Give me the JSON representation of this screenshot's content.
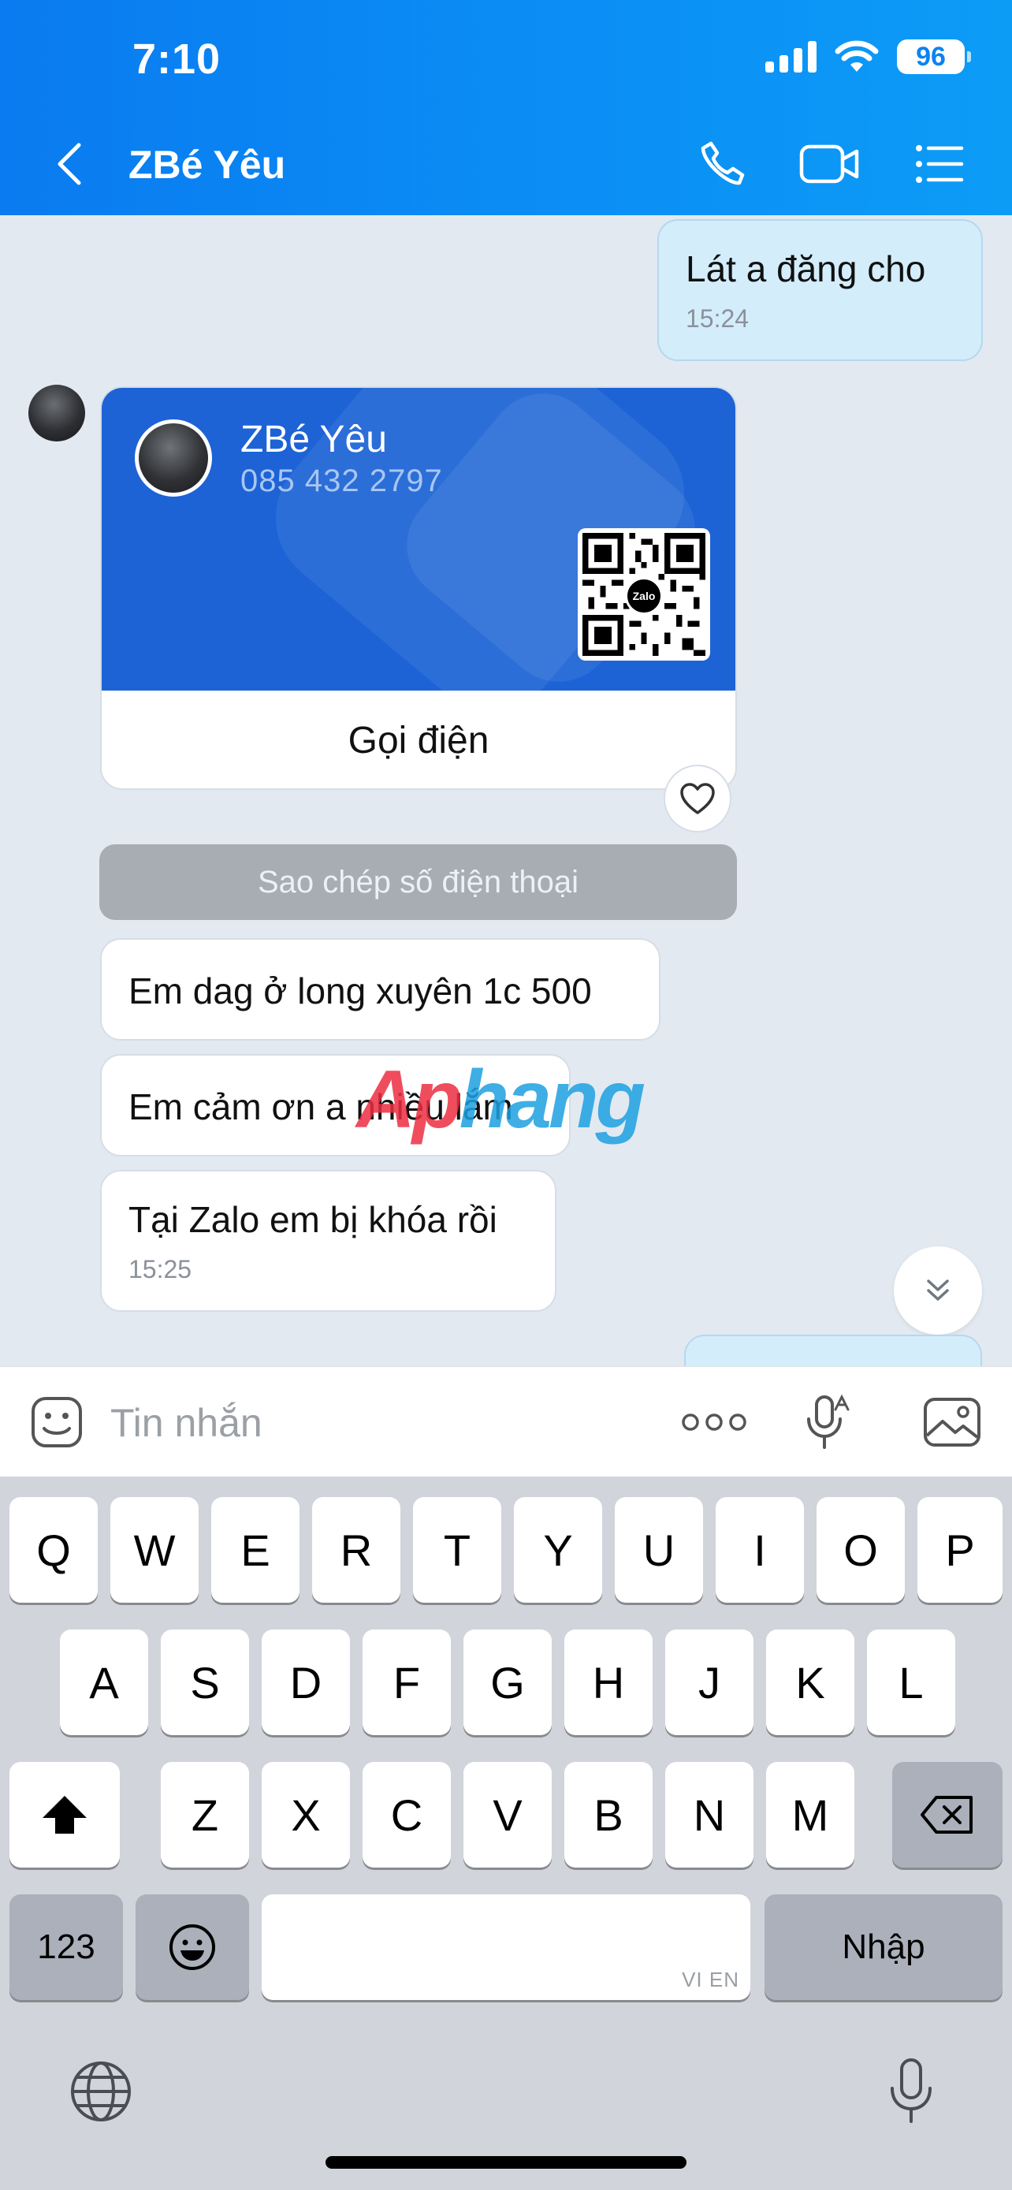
{
  "status_bar": {
    "time": "7:10",
    "battery": "96"
  },
  "header": {
    "contact_name": "ZBé Yêu"
  },
  "messages": {
    "outgoing_1": {
      "text": "Lát a đăng cho",
      "time": "15:24"
    },
    "contact_card": {
      "name": "ZBé Yêu",
      "phone": "085 432 2797",
      "qr_logo": "Zalo",
      "call_label": "Gọi điện"
    },
    "copy_phone_label": "Sao chép số điện thoại",
    "incoming_1": {
      "text": "Em dag ở long xuyên 1c 500"
    },
    "incoming_2": {
      "text": "Em cảm ơn a nhiều lắm"
    },
    "incoming_3": {
      "text": "Tại Zalo em bị khóa rồi",
      "time": "15:25"
    }
  },
  "watermark": {
    "part1": "Ap",
    "part2": "hang"
  },
  "input_bar": {
    "placeholder": "Tin nhắn"
  },
  "keyboard": {
    "row1": [
      "Q",
      "W",
      "E",
      "R",
      "T",
      "Y",
      "U",
      "I",
      "O",
      "P"
    ],
    "row2": [
      "A",
      "S",
      "D",
      "F",
      "G",
      "H",
      "J",
      "K",
      "L"
    ],
    "row3": [
      "Z",
      "X",
      "C",
      "V",
      "B",
      "N",
      "M"
    ],
    "numbers_key": "123",
    "return_key": "Nhập",
    "space_hint": "VI EN"
  },
  "colors": {
    "header_blue": "#0a84f2",
    "card_blue": "#1d63d6",
    "outgoing_bubble": "#d4edfb"
  }
}
